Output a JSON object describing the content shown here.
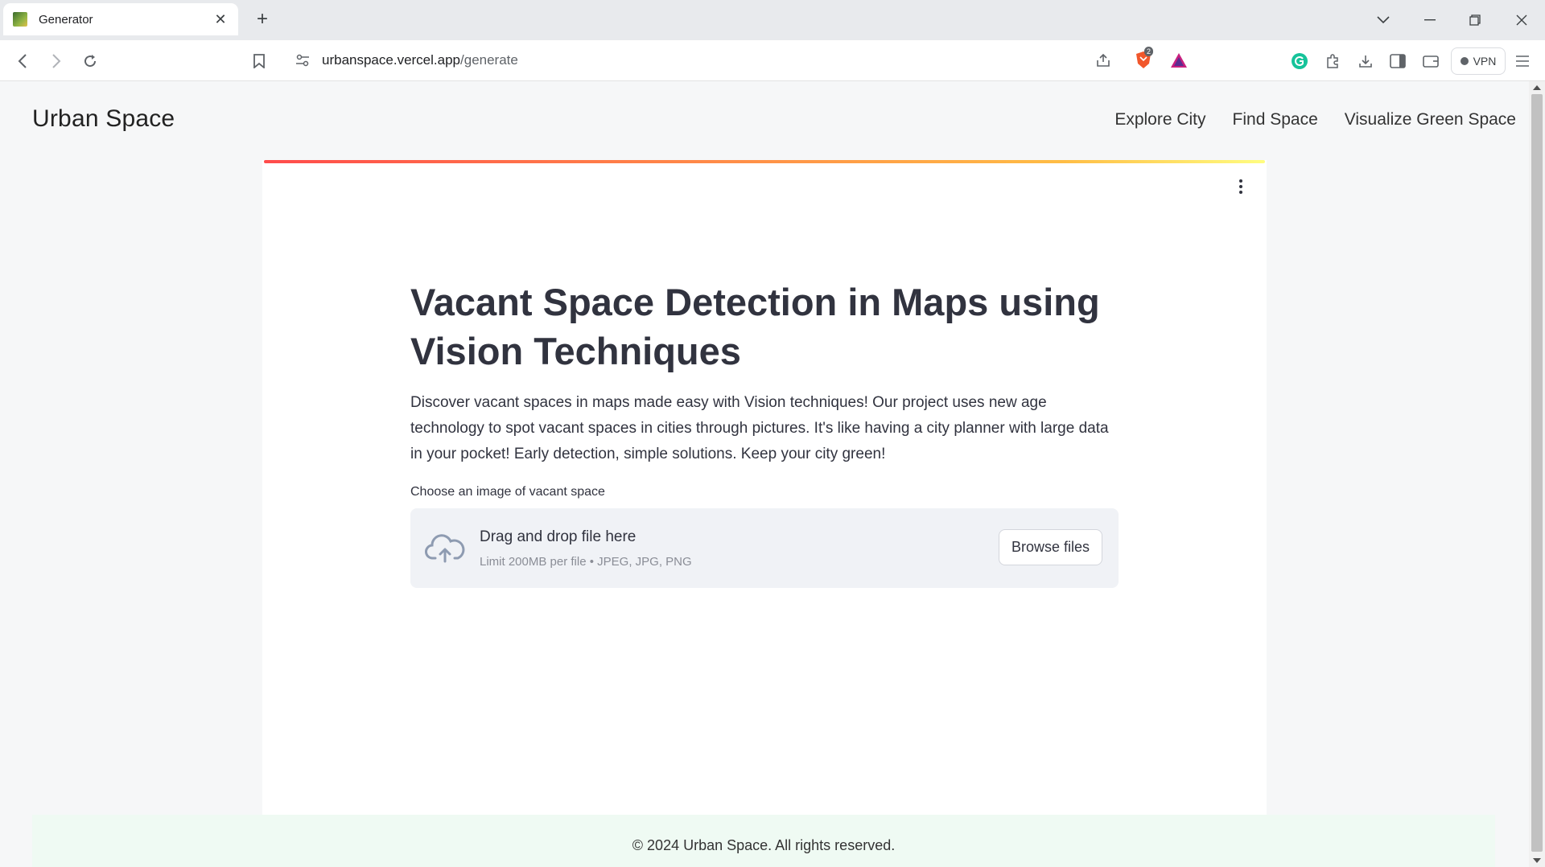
{
  "browser": {
    "tab_title": "Generator",
    "url_host": "urbanspace.vercel.app",
    "url_path": "/generate",
    "vpn_label": "VPN",
    "brave_badge": "2"
  },
  "site": {
    "brand": "Urban Space",
    "nav": [
      "Explore City",
      "Find Space",
      "Visualize Green Space"
    ]
  },
  "main": {
    "heading": "Vacant Space Detection in Maps using Vision Techniques",
    "description": "Discover vacant spaces in maps made easy with Vision techniques! Our project uses new age technology to spot vacant spaces in cities through pictures. It's like having a city planner with large data in your pocket! Early detection, simple solutions. Keep your city green!",
    "upload_label": "Choose an image of vacant space",
    "dropzone_title": "Drag and drop file here",
    "dropzone_limit": "Limit 200MB per file • JPEG, JPG, PNG",
    "browse_label": "Browse files"
  },
  "footer": {
    "text": "© 2024 Urban Space. All rights reserved."
  },
  "colors": {
    "accent_gradient_start": "#ff4b4b",
    "accent_gradient_end": "#fffd80",
    "footer_bg": "#effaf3",
    "dropzone_bg": "#f0f2f6"
  }
}
